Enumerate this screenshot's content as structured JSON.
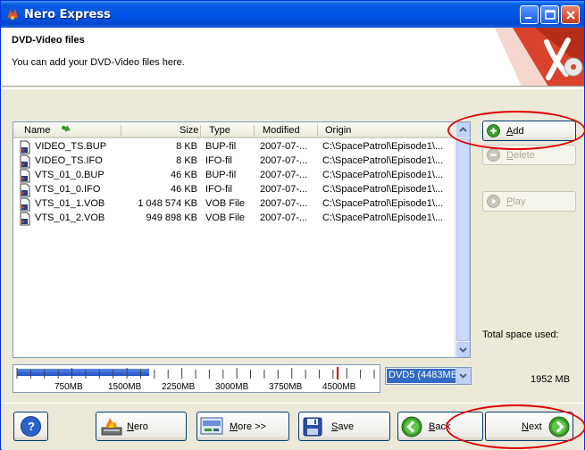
{
  "window": {
    "title": "Nero Express"
  },
  "header": {
    "title": "DVD-Video files",
    "subtitle": "You can add your DVD-Video files here."
  },
  "filelist": {
    "columns": [
      "Name",
      "Size",
      "Type",
      "Modified",
      "Origin"
    ],
    "rows": [
      {
        "name": "VIDEO_TS.BUP",
        "size": "8 KB",
        "type": "BUP-fil",
        "modified": "2007-07-...",
        "origin": "C:\\SpacePatrol\\Episode1\\..."
      },
      {
        "name": "VIDEO_TS.IFO",
        "size": "8 KB",
        "type": "IFO-fil",
        "modified": "2007-07-...",
        "origin": "C:\\SpacePatrol\\Episode1\\..."
      },
      {
        "name": "VTS_01_0.BUP",
        "size": "46 KB",
        "type": "BUP-fil",
        "modified": "2007-07-...",
        "origin": "C:\\SpacePatrol\\Episode1\\..."
      },
      {
        "name": "VTS_01_0.IFO",
        "size": "46 KB",
        "type": "IFO-fil",
        "modified": "2007-07-...",
        "origin": "C:\\SpacePatrol\\Episode1\\..."
      },
      {
        "name": "VTS_01_1.VOB",
        "size": "1 048 574 KB",
        "type": "VOB File",
        "modified": "2007-07-...",
        "origin": "C:\\SpacePatrol\\Episode1\\..."
      },
      {
        "name": "VTS_01_2.VOB",
        "size": "949 898 KB",
        "type": "VOB File",
        "modified": "2007-07-...",
        "origin": "C:\\SpacePatrol\\Episode1\\..."
      }
    ]
  },
  "side": {
    "add": {
      "first": "A",
      "rest": "dd"
    },
    "delete": {
      "first": "D",
      "rest": "elete"
    },
    "play": {
      "first": "P",
      "rest": "lay"
    },
    "total_label": "Total space used:",
    "total_value": "1952 MB"
  },
  "capacity": {
    "ticks": [
      "750MB",
      "1500MB",
      "2250MB",
      "3000MB",
      "3750MB",
      "4500MB"
    ],
    "used_fraction": 0.37,
    "disc": "DVD5 (4483MB"
  },
  "buttons": {
    "help": "?",
    "nero": {
      "first": "N",
      "rest": "ero"
    },
    "more": {
      "first": "M",
      "rest": "ore >>"
    },
    "save": {
      "first": "S",
      "rest": "ave"
    },
    "back": {
      "first": "B",
      "rest": "ack"
    },
    "next": {
      "first": "N",
      "rest": "ext"
    }
  },
  "colors": {
    "titlebar": "#0055e5",
    "highlight": "#e00000",
    "selection": "#316ac5"
  }
}
